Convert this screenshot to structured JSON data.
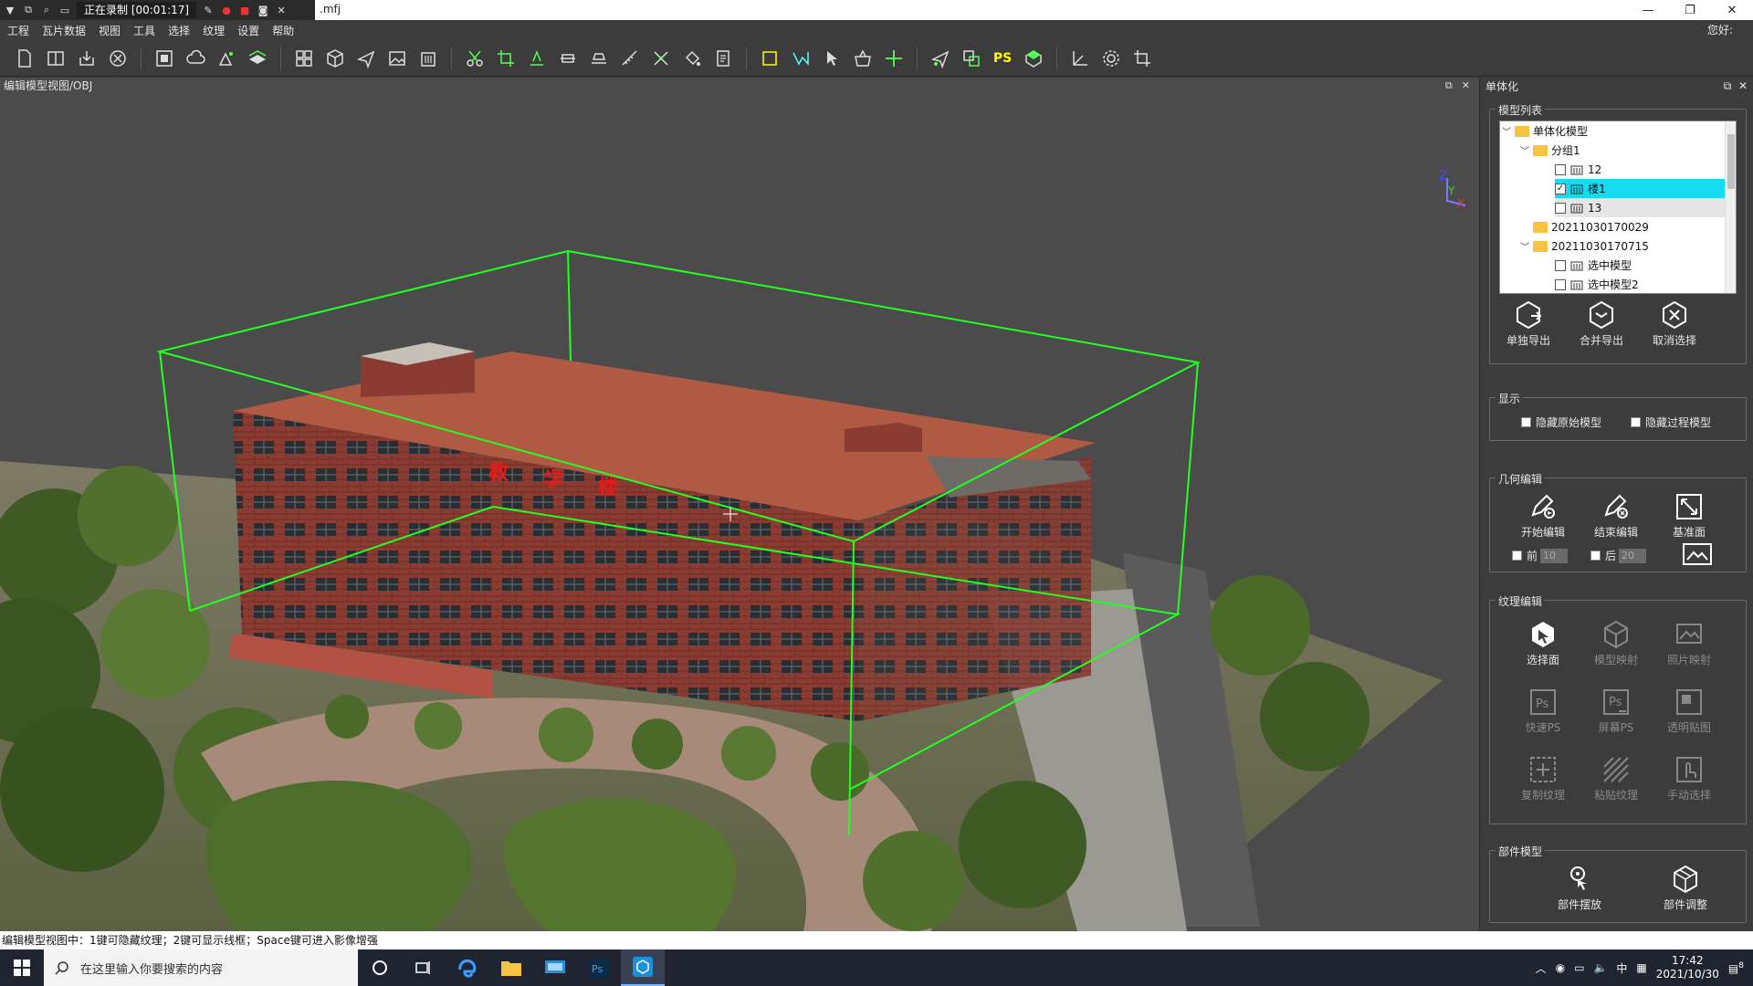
{
  "titlebar": {
    "recording_status": "正在录制 [00:01:17]",
    "title_suffix": ".mfj",
    "minimize": "—",
    "restore": "❐",
    "close": "✕"
  },
  "menu": {
    "items": [
      "工程",
      "瓦片数据",
      "视图",
      "工具",
      "选择",
      "纹理",
      "设置",
      "帮助"
    ],
    "user": "您好:"
  },
  "toolbar": {
    "icons": [
      "new-file-icon",
      "split-view-icon",
      "import-icon",
      "close-circle-icon",
      "stop-icon",
      "cloud-icon",
      "paint-icon",
      "layers-icon",
      "grid-icon",
      "cube-icon",
      "plane-icon",
      "image-icon",
      "building-icon",
      "scissors-icon",
      "crop-icon",
      "trim-icon",
      "slice-icon",
      "flatten-icon",
      "measure-icon",
      "cut-icon",
      "fill-icon",
      "document-icon",
      "select-rect-icon",
      "select-poly-icon",
      "select-pointer-icon",
      "select-basket-icon",
      "move-icon",
      "plane2-icon",
      "overlap-icon",
      "ps-icon",
      "box-icon",
      "axis-icon",
      "settings-icon",
      "crop2-icon"
    ],
    "ps_label": "PS"
  },
  "viewport": {
    "title": "编辑模型视图/OBJ",
    "axis_labels": {
      "z": "Z",
      "y": "Y",
      "x": "X"
    },
    "sign_text": [
      "教",
      "学",
      "楼"
    ]
  },
  "panel": {
    "title": "单体化",
    "model_list": {
      "title": "模型列表",
      "tree": [
        {
          "label": "单体化模型",
          "type": "folder",
          "expanded": true,
          "level": 0
        },
        {
          "label": "分组1",
          "type": "folder",
          "expanded": true,
          "level": 1
        },
        {
          "label": "12",
          "type": "model",
          "checked": false,
          "level": 2
        },
        {
          "label": "楼1",
          "type": "model",
          "checked": true,
          "selected": true,
          "level": 2
        },
        {
          "label": "13",
          "type": "model",
          "checked": false,
          "level": 2
        },
        {
          "label": "20211030170029",
          "type": "folder",
          "expanded": false,
          "level": 1
        },
        {
          "label": "20211030170715",
          "type": "folder",
          "expanded": true,
          "level": 1
        },
        {
          "label": "选中模型",
          "type": "model",
          "checked": false,
          "level": 2
        },
        {
          "label": "选中模型2",
          "type": "model",
          "checked": false,
          "level": 2
        }
      ],
      "buttons": [
        "单独导出",
        "合并导出",
        "取消选择"
      ]
    },
    "display": {
      "title": "显示",
      "options": [
        "隐藏原始模型",
        "隐藏过程模型"
      ]
    },
    "geometry": {
      "title": "几何编辑",
      "buttons": [
        "开始编辑",
        "结束编辑",
        "基准面"
      ],
      "front_label": "前",
      "front_value": "10",
      "back_label": "后",
      "back_value": "20"
    },
    "texture": {
      "title": "纹理编辑",
      "buttons": [
        "选择面",
        "模型映射",
        "照片映射",
        "快速PS",
        "屏幕PS",
        "透明贴图",
        "复制纹理",
        "粘贴纹理",
        "手动选择"
      ]
    },
    "parts": {
      "title": "部件模型",
      "buttons": [
        "部件摆放",
        "部件调整"
      ]
    }
  },
  "statusbar": {
    "text": "编辑模型视图中：1键可隐藏纹理；2键可显示线框；Space键可进入影像增强"
  },
  "taskbar": {
    "search_placeholder": "在这里输入你要搜索的内容",
    "ime": "中",
    "time": "17:42",
    "date": "2021/10/30",
    "notification_count": "8"
  },
  "colors": {
    "bbox": "#22ff22",
    "selection": "#17d9f0",
    "brick": "#8a3c32",
    "roof": "#b05a44"
  }
}
